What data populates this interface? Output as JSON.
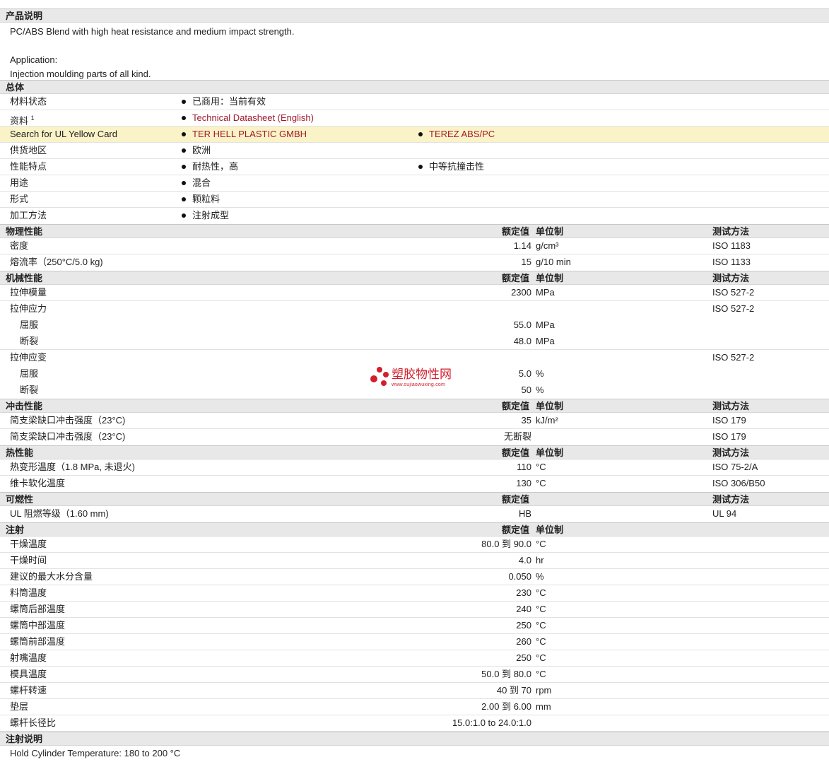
{
  "sections": {
    "desc": {
      "title": "产品说明",
      "line1": "PC/ABS Blend with high heat resistance and medium impact strength.",
      "line2": "Application:",
      "line3": "Injection moulding parts of all kind."
    },
    "general": {
      "title": "总体",
      "status_label": "材料状态",
      "status_value": "已商用：当前有效",
      "docs_label": "资料",
      "docs_sup": "1",
      "docs_link": "Technical Datasheet (English)",
      "ul_label": "Search for UL Yellow Card",
      "ul_link1": "TER HELL PLASTIC GMBH",
      "ul_link2": "TEREZ ABS/PC",
      "region_label": "供货地区",
      "region_value": "欧洲",
      "feat_label": "性能特点",
      "feat_value1": "耐热性，高",
      "feat_value2": "中等抗撞击性",
      "use_label": "用途",
      "use_value": "混合",
      "form_label": "形式",
      "form_value": "颗粒料",
      "proc_label": "加工方法",
      "proc_value": "注射成型"
    },
    "col_headers": {
      "nominal": "额定值",
      "unit": "单位制",
      "test": "测试方法"
    },
    "physical": {
      "title": "物理性能",
      "rows": [
        {
          "label": "密度",
          "value": "1.14",
          "unit": "g/cm³",
          "test": "ISO 1183"
        },
        {
          "label": "熔流率（250°C/5.0 kg)",
          "value": "15",
          "unit": "g/10 min",
          "test": "ISO 1133"
        }
      ]
    },
    "mechanical": {
      "title": "机械性能",
      "modulus": {
        "label": "拉伸模量",
        "value": "2300",
        "unit": "MPa",
        "test": "ISO 527-2"
      },
      "stress": {
        "label": "拉伸应力",
        "test": "ISO 527-2"
      },
      "stress_yield": {
        "label": "屈服",
        "value": "55.0",
        "unit": "MPa"
      },
      "stress_break": {
        "label": "断裂",
        "value": "48.0",
        "unit": "MPa"
      },
      "strain": {
        "label": "拉伸应变",
        "test": "ISO 527-2"
      },
      "strain_yield": {
        "label": "屈服",
        "value": "5.0",
        "unit": "%"
      },
      "strain_break": {
        "label": "断裂",
        "value": "50",
        "unit": "%"
      }
    },
    "impact": {
      "title": "冲击性能",
      "rows": [
        {
          "label": "简支梁缺口冲击强度（23°C)",
          "value": "35",
          "unit": "kJ/m²",
          "test": "ISO 179"
        },
        {
          "label": "简支梁缺口冲击强度（23°C)",
          "value": "无断裂",
          "unit": "",
          "test": "ISO 179"
        }
      ]
    },
    "thermal": {
      "title": "热性能",
      "rows": [
        {
          "label": "热变形温度（1.8 MPa, 未退火)",
          "value": "110",
          "unit": "°C",
          "test": "ISO 75-2/A"
        },
        {
          "label": "维卡软化温度",
          "value": "130",
          "unit": "°C",
          "test": "ISO 306/B50"
        }
      ]
    },
    "flammability": {
      "title": "可燃性",
      "rows": [
        {
          "label": "UL 阻燃等级（1.60 mm)",
          "value": "HB",
          "unit": "",
          "test": "UL 94"
        }
      ]
    },
    "injection": {
      "title": "注射",
      "rows": [
        {
          "label": "干燥温度",
          "value": "80.0 到  90.0",
          "unit": "°C"
        },
        {
          "label": "干燥时间",
          "value": "4.0",
          "unit": "hr"
        },
        {
          "label": "建议的最大水分含量",
          "value": "0.050",
          "unit": "%"
        },
        {
          "label": "料筒温度",
          "value": "230",
          "unit": "°C"
        },
        {
          "label": "螺筒后部温度",
          "value": "240",
          "unit": "°C"
        },
        {
          "label": "螺筒中部温度",
          "value": "250",
          "unit": "°C"
        },
        {
          "label": "螺筒前部温度",
          "value": "260",
          "unit": "°C"
        },
        {
          "label": "射嘴温度",
          "value": "250",
          "unit": "°C"
        },
        {
          "label": "模具温度",
          "value": "50.0 到  80.0",
          "unit": "°C"
        },
        {
          "label": "螺杆转速",
          "value": "40 到  70",
          "unit": "rpm"
        },
        {
          "label": "垫层",
          "value": "2.00 到  6.00",
          "unit": "mm"
        },
        {
          "label": "螺杆长径比",
          "value": "15.0:1.0 to 24.0:1.0",
          "unit": ""
        }
      ]
    },
    "inj_notes": {
      "title": "注射说明",
      "text": "Hold Cylinder Temperature: 180 to 200 °C"
    }
  },
  "watermark": {
    "name": "塑胶物性网",
    "url": "www.sujiaowuxing.com",
    "color": "#d21f2d"
  }
}
